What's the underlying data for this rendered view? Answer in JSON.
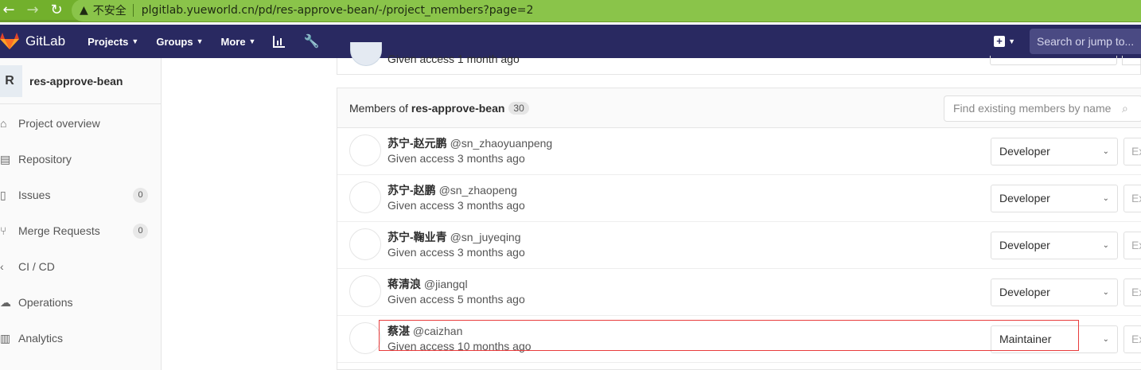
{
  "browser": {
    "back_icon": "arrow-left-icon",
    "forward_icon": "arrow-right-icon",
    "reload_icon": "reload-icon",
    "warning_icon": "warning-icon",
    "insecure_label": "不安全",
    "url": "plgitlab.yueworld.cn/pd/res-approve-bean/-/project_members?page=2",
    "bar_color": "#72b02c"
  },
  "header": {
    "app_name": "GitLab",
    "menu": [
      {
        "label": "Projects"
      },
      {
        "label": "Groups"
      },
      {
        "label": "More"
      }
    ],
    "search_placeholder": "Search or jump to...",
    "bg_color": "#292961"
  },
  "sidebar": {
    "project_initial": "R",
    "project_name": "res-approve-bean",
    "items": [
      {
        "label": "Project overview",
        "icon": "home-icon"
      },
      {
        "label": "Repository",
        "icon": "document-icon"
      },
      {
        "label": "Issues",
        "icon": "issues-icon",
        "count": "0"
      },
      {
        "label": "Merge Requests",
        "icon": "merge-request-icon",
        "count": "0"
      },
      {
        "label": "CI / CD",
        "icon": "rocket-icon"
      },
      {
        "label": "Operations",
        "icon": "cloud-icon"
      },
      {
        "label": "Analytics",
        "icon": "chart-icon"
      }
    ]
  },
  "previous_member": {
    "access": "Given access 1 month ago"
  },
  "members_panel": {
    "title_prefix": "Members of",
    "project": "res-approve-bean",
    "count": "30",
    "filter_placeholder": "Find existing members by name",
    "members": [
      {
        "name": "苏宁-赵元鹏",
        "username": "@sn_zhaoyuanpeng",
        "access": "Given access 3 months ago",
        "role": "Developer",
        "expiry": "Ex"
      },
      {
        "name": "苏宁-赵鹏",
        "username": "@sn_zhaopeng",
        "access": "Given access 3 months ago",
        "role": "Developer",
        "expiry": "Ex"
      },
      {
        "name": "苏宁-鞠业青",
        "username": "@sn_juyeqing",
        "access": "Given access 3 months ago",
        "role": "Developer",
        "expiry": "Ex"
      },
      {
        "name": "蒋清浪",
        "username": "@jiangql",
        "access": "Given access 5 months ago",
        "role": "Developer",
        "expiry": "Ex"
      },
      {
        "name": "蔡湛",
        "username": "@caizhan",
        "access": "Given access 10 months ago",
        "role": "Maintainer",
        "expiry": "Ex"
      }
    ]
  },
  "annotation": {
    "highlight_color": "#e83d3d"
  }
}
